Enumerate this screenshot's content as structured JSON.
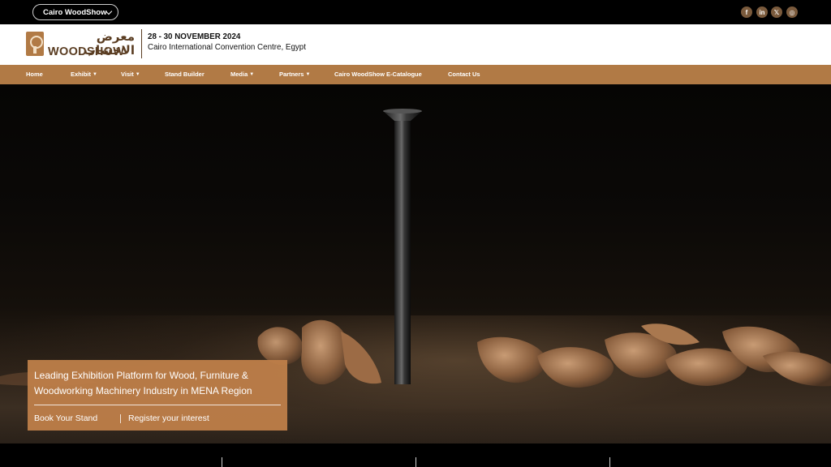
{
  "topbar": {
    "site_selector": "Cairo WoodShow",
    "social_icons": [
      "facebook-icon",
      "linkedin-icon",
      "x-icon",
      "instagram-icon"
    ],
    "social_glyphs": [
      "f",
      "in",
      "𝕏",
      "◎"
    ]
  },
  "header": {
    "logo_arabic": "معرض الاخشاب",
    "logo_word": "WOODSHOW",
    "event_date": "28 - 30 NOVEMBER 2024",
    "event_venue": "Cairo International Convention Centre, Egypt"
  },
  "nav": {
    "items": [
      {
        "label": "Home",
        "dropdown": false
      },
      {
        "label": "Exhibit",
        "dropdown": true
      },
      {
        "label": "Visit",
        "dropdown": true
      },
      {
        "label": "Stand Builder",
        "dropdown": false
      },
      {
        "label": "Media",
        "dropdown": true
      },
      {
        "label": "Partners",
        "dropdown": true
      },
      {
        "label": "Cairo WoodShow E-Catalogue",
        "dropdown": false
      },
      {
        "label": "Contact Us",
        "dropdown": false
      }
    ],
    "caret": "▼"
  },
  "hero": {
    "headline": "Leading Exhibition Platform for Wood, Furniture & Woodworking Machinery Industry in MENA Region",
    "cta_primary": "Book Your Stand",
    "cta_secondary": "Register your interest"
  },
  "colors": {
    "brand_brown": "#b17a45",
    "dark_brown": "#5a3d22",
    "promo_bg": "#bf8049",
    "social_bg": "#7a5a3c"
  }
}
